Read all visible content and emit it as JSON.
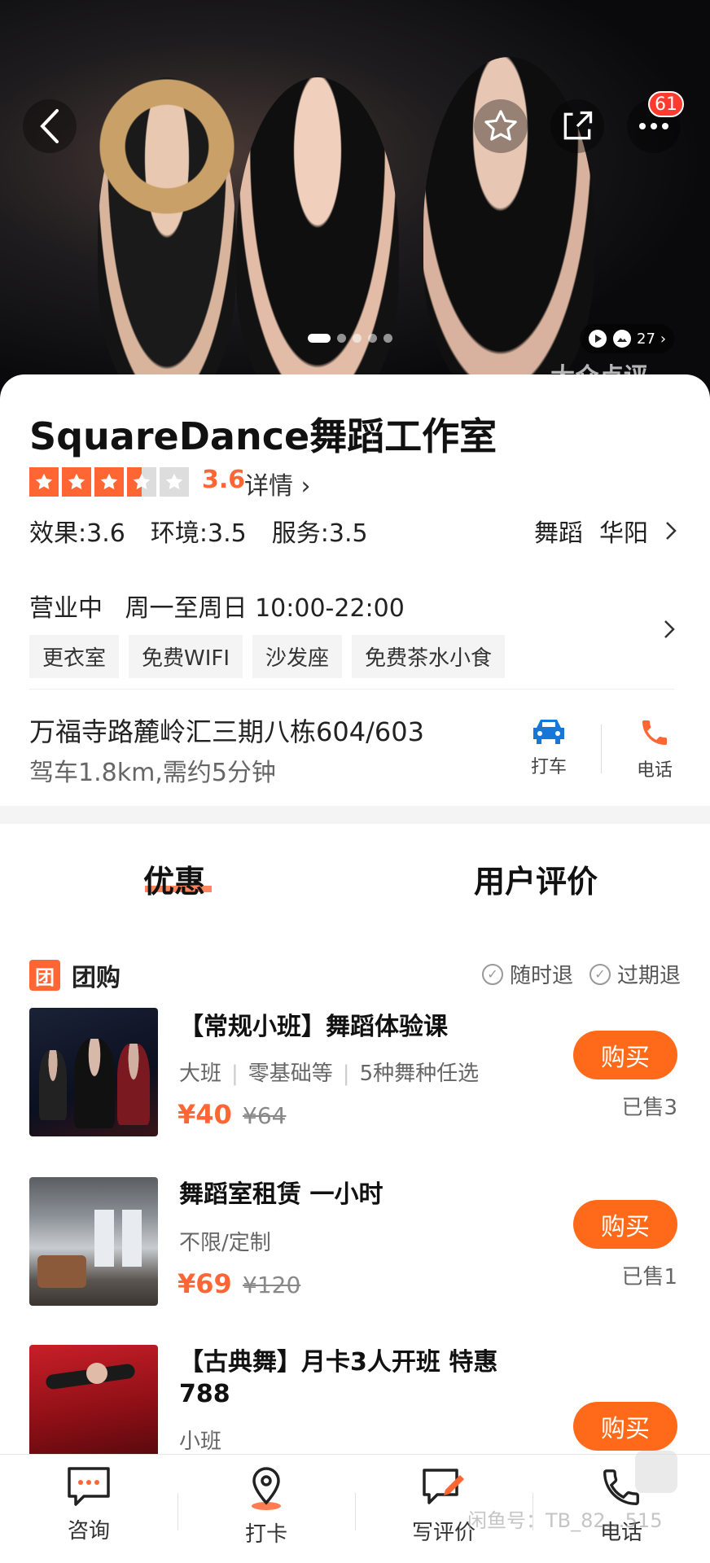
{
  "hero": {
    "badge_count": "61",
    "photo_count": "27",
    "dots_total": 5,
    "dots_active": 1,
    "watermark": "大众点评"
  },
  "shop": {
    "name": "SquareDance舞蹈工作室",
    "rating": "3.6",
    "rating_value": 3.6,
    "detail_label": "详情",
    "scores": "效果:3.6  环境:3.5  服务:3.5",
    "category": "舞蹈",
    "area": "华阳",
    "status": "营业中",
    "hours": "周一至周日 10:00-22:00",
    "tags": [
      "更衣室",
      "免费WIFI",
      "沙发座",
      "免费茶水小食"
    ],
    "address": "万福寺路麓岭汇三期八栋604/603",
    "distance": "驾车1.8km,需约5分钟",
    "taxi_label": "打车",
    "phone_label": "电话"
  },
  "tabs": {
    "t1": "优惠",
    "t2": "用户评价"
  },
  "group": {
    "icon_text": "团",
    "title": "团购",
    "guarantee1": "随时退",
    "guarantee2": "过期退"
  },
  "deals": [
    {
      "title": "【常规小班】舞蹈体验课",
      "tags": [
        "大班",
        "零基础等",
        "5种舞种任选"
      ],
      "price": "¥40",
      "orig": "¥64",
      "buy": "购买",
      "sold": "已售3"
    },
    {
      "title": "舞蹈室租赁 一小时",
      "tags": [
        "不限/定制"
      ],
      "price": "¥69",
      "orig": "¥120",
      "buy": "购买",
      "sold": "已售1"
    },
    {
      "title": "【古典舞】月卡3人开班 特惠 788",
      "tags": [
        "小班"
      ],
      "buy": "购买"
    }
  ],
  "bottom": {
    "consult": "咨询",
    "checkin": "打卡",
    "review": "写评价",
    "phone": "电话",
    "watermark": "闲鱼号：TB_82…515"
  },
  "colors": {
    "accent": "#ff6633",
    "buy": "#ff6a1a",
    "taxi": "#1677d8"
  }
}
